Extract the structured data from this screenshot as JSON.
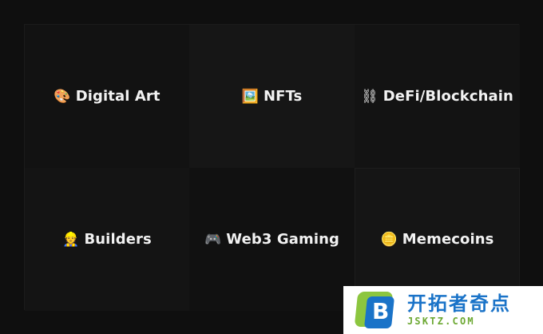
{
  "categories": [
    {
      "emoji": "🎨",
      "label": "Digital Art"
    },
    {
      "emoji": "🖼️",
      "label": "NFTs"
    },
    {
      "emoji": "⛓",
      "label": "DeFi/Blockchain"
    },
    {
      "emoji": "👷",
      "label": "Builders"
    },
    {
      "emoji": "🎮",
      "label": "Web3 Gaming"
    },
    {
      "emoji": "🪙",
      "label": "Memecoins"
    }
  ],
  "watermark": {
    "logo_letter": "B",
    "title": "开拓者奇点",
    "url": "JSKTZ.COM"
  },
  "colors": {
    "background": "#0f0f0f",
    "tile_text": "#f2f2f2",
    "watermark_blue": "#1a73c8",
    "watermark_green": "#8cc63f"
  }
}
